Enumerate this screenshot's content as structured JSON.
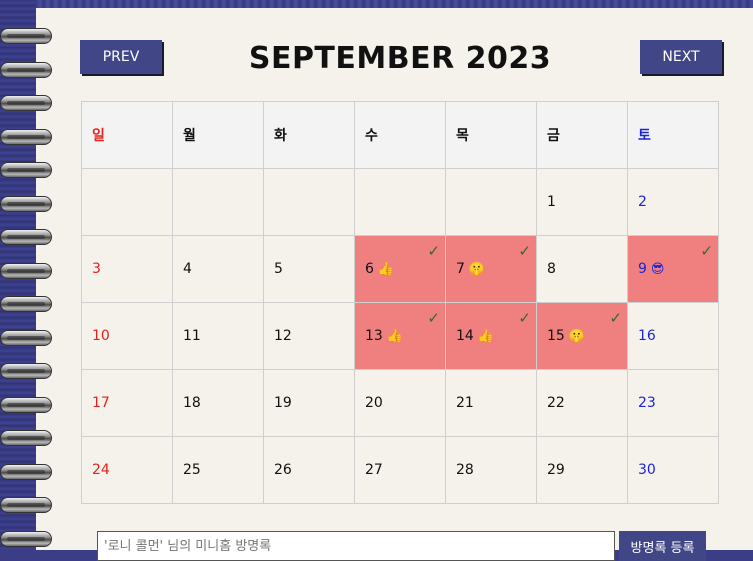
{
  "header": {
    "prev_label": "PREV",
    "next_label": "NEXT",
    "month_title": "SEPTEMBER 2023"
  },
  "weekdays": [
    "일",
    "월",
    "화",
    "수",
    "목",
    "금",
    "토"
  ],
  "calendar": {
    "rows": [
      [
        null,
        null,
        null,
        null,
        null,
        {
          "day": "1"
        },
        {
          "day": "2"
        }
      ],
      [
        {
          "day": "3"
        },
        {
          "day": "4"
        },
        {
          "day": "5"
        },
        {
          "day": "6",
          "emoji": "👍",
          "marked": true
        },
        {
          "day": "7",
          "emoji": "🤫",
          "marked": true
        },
        {
          "day": "8"
        },
        {
          "day": "9",
          "emoji": "😎",
          "marked": true
        }
      ],
      [
        {
          "day": "10"
        },
        {
          "day": "11"
        },
        {
          "day": "12"
        },
        {
          "day": "13",
          "emoji": "👍",
          "marked": true
        },
        {
          "day": "14",
          "emoji": "👍",
          "marked": true
        },
        {
          "day": "15",
          "emoji": "🤫",
          "marked": true
        },
        {
          "day": "16"
        }
      ],
      [
        {
          "day": "17"
        },
        {
          "day": "18"
        },
        {
          "day": "19"
        },
        {
          "day": "20"
        },
        {
          "day": "21"
        },
        {
          "day": "22"
        },
        {
          "day": "23"
        }
      ],
      [
        {
          "day": "24"
        },
        {
          "day": "25"
        },
        {
          "day": "26"
        },
        {
          "day": "27"
        },
        {
          "day": "28"
        },
        {
          "day": "29"
        },
        {
          "day": "30"
        }
      ]
    ],
    "check_mark": "✓"
  },
  "guestbook": {
    "placeholder": "'로니 콜먼' 님의 미니홈 방명록",
    "button_label": "방명록 등록"
  },
  "colors": {
    "button_bg": "#414687",
    "marked_bg": "#f08080",
    "sunday": "#e0231f",
    "saturday": "#1a25d8",
    "page_bg": "#f4f2ea",
    "cover_bg": "#3b3d86"
  }
}
